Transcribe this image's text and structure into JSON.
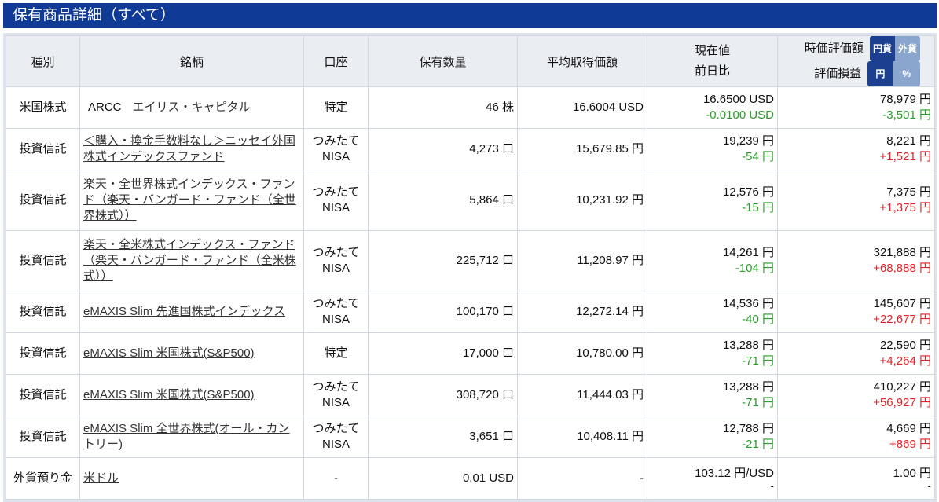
{
  "title": "保有商品詳細（すべて）",
  "headers": {
    "category": "種別",
    "name": "銘柄",
    "account": "口座",
    "quantity": "保有数量",
    "avg_cost": "平均取得価額",
    "current_price": "現在値",
    "day_change": "前日比",
    "valuation": "時価評価額",
    "gain": "評価損益",
    "valuation_toggle": [
      "円貨",
      "外貨"
    ],
    "gain_toggle": [
      "円",
      "%"
    ]
  },
  "rows": [
    {
      "category": "米国株式",
      "ticker": "ARCC",
      "name": "エイリス・キャピタル",
      "account": "特定",
      "quantity": "46 株",
      "avg_cost": "16.6004 USD",
      "price": "16.6500 USD",
      "change": "-0.0100 USD",
      "valuation": "78,979 円",
      "gain": "-3,501 円"
    },
    {
      "category": "投資信託",
      "name": "＜購入・換金手数料なし＞ニッセイ外国株式インデックスファンド",
      "account": "つみたてNISA",
      "quantity": "4,273 口",
      "avg_cost": "15,679.85 円",
      "price": "19,239 円",
      "change": "-54 円",
      "valuation": "8,221 円",
      "gain": "+1,521 円"
    },
    {
      "category": "投資信託",
      "name": "楽天・全世界株式インデックス・ファンド（楽天・バンガード・ファンド（全世界株式））",
      "account": "つみたてNISA",
      "quantity": "5,864 口",
      "avg_cost": "10,231.92 円",
      "price": "12,576 円",
      "change": "-15 円",
      "valuation": "7,375 円",
      "gain": "+1,375 円"
    },
    {
      "category": "投資信託",
      "name": "楽天・全米株式インデックス・ファンド（楽天・バンガード・ファンド（全米株式））",
      "account": "つみたてNISA",
      "quantity": "225,712 口",
      "avg_cost": "11,208.97 円",
      "price": "14,261 円",
      "change": "-104 円",
      "valuation": "321,888 円",
      "gain": "+68,888 円"
    },
    {
      "category": "投資信託",
      "name": "eMAXIS Slim 先進国株式インデックス",
      "account": "つみたてNISA",
      "quantity": "100,170 口",
      "avg_cost": "12,272.14 円",
      "price": "14,536 円",
      "change": "-40 円",
      "valuation": "145,607 円",
      "gain": "+22,677 円"
    },
    {
      "category": "投資信託",
      "name": "eMAXIS Slim 米国株式(S&P500)",
      "account": "特定",
      "quantity": "17,000 口",
      "avg_cost": "10,780.00 円",
      "price": "13,288 円",
      "change": "-71 円",
      "valuation": "22,590 円",
      "gain": "+4,264 円"
    },
    {
      "category": "投資信託",
      "name": "eMAXIS Slim 米国株式(S&P500)",
      "account": "つみたてNISA",
      "quantity": "308,720 口",
      "avg_cost": "11,444.03 円",
      "price": "13,288 円",
      "change": "-71 円",
      "valuation": "410,227 円",
      "gain": "+56,927 円"
    },
    {
      "category": "投資信託",
      "name": "eMAXIS Slim 全世界株式(オール・カントリー)",
      "account": "つみたてNISA",
      "quantity": "3,651 口",
      "avg_cost": "10,408.11 円",
      "price": "12,788 円",
      "change": "-21 円",
      "valuation": "4,669 円",
      "gain": "+869 円"
    },
    {
      "category": "外貨預り金",
      "name": "米ドル",
      "account": "-",
      "quantity": "0.01 USD",
      "avg_cost": "-",
      "price": "103.12 円/USD",
      "change": "-",
      "valuation": "1.00 円",
      "gain": "-"
    }
  ],
  "colors": {
    "title_bg": "#0f3a96",
    "header_bg": "#eaedf2",
    "negative": "#2a9c2a",
    "positive": "#e1242a"
  }
}
